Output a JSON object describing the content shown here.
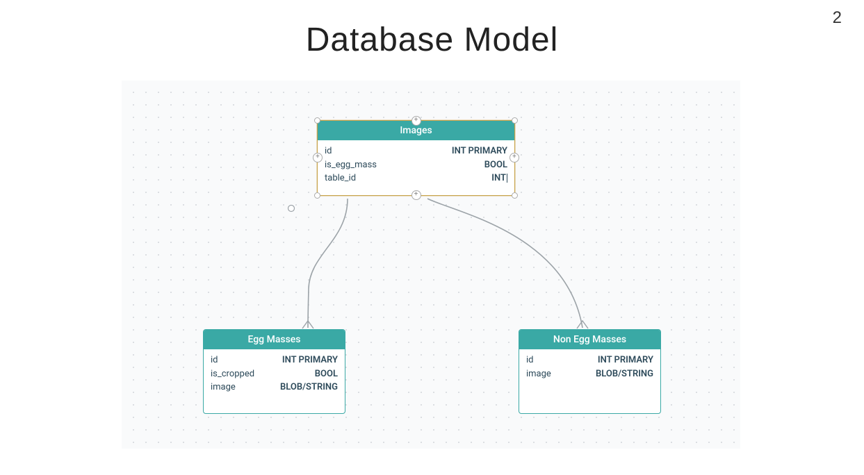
{
  "page_number": "2",
  "title": "Database Model",
  "entities": {
    "images": {
      "title": "Images",
      "columns": [
        {
          "name": "id",
          "type": "INT PRIMARY"
        },
        {
          "name": "is_egg_mass",
          "type": "BOOL"
        },
        {
          "name": "table_id",
          "type": "INT"
        }
      ]
    },
    "egg_masses": {
      "title": "Egg Masses",
      "columns": [
        {
          "name": "id",
          "type": "INT PRIMARY"
        },
        {
          "name": "is_cropped",
          "type": "BOOL"
        },
        {
          "name": "image",
          "type": "BLOB/STRING"
        }
      ]
    },
    "non_egg_masses": {
      "title": "Non Egg Masses",
      "columns": [
        {
          "name": "id",
          "type": "INT PRIMARY"
        },
        {
          "name": "image",
          "type": "BLOB/STRING"
        }
      ]
    }
  }
}
